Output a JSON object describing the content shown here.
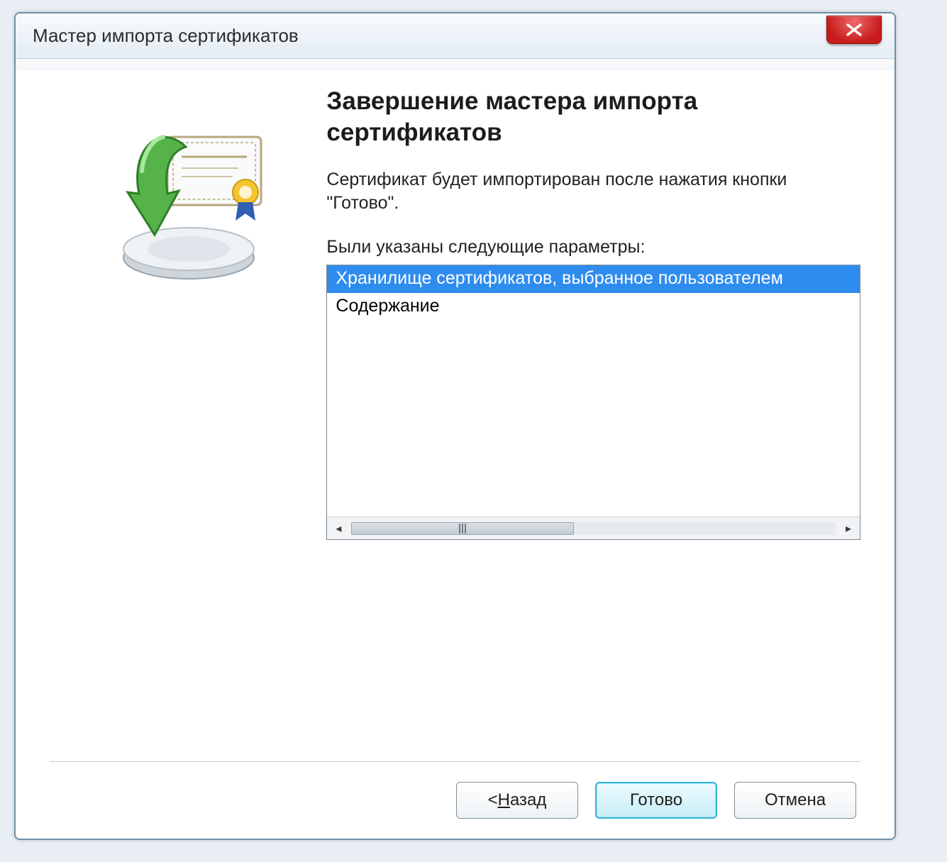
{
  "window": {
    "title": "Мастер импорта сертификатов"
  },
  "main": {
    "heading": "Завершение мастера импорта сертификатов",
    "description": "Сертификат будет импортирован после нажатия кнопки \"Готово\".",
    "params_label": "Были указаны следующие параметры:",
    "list_items": [
      "Хранилище сертификатов, выбранное пользователем",
      "Содержание"
    ],
    "selected_index": 0
  },
  "buttons": {
    "back_prefix": "< ",
    "back_underline": "Н",
    "back_rest": "азад",
    "finish": "Готово",
    "cancel": "Отмена"
  }
}
